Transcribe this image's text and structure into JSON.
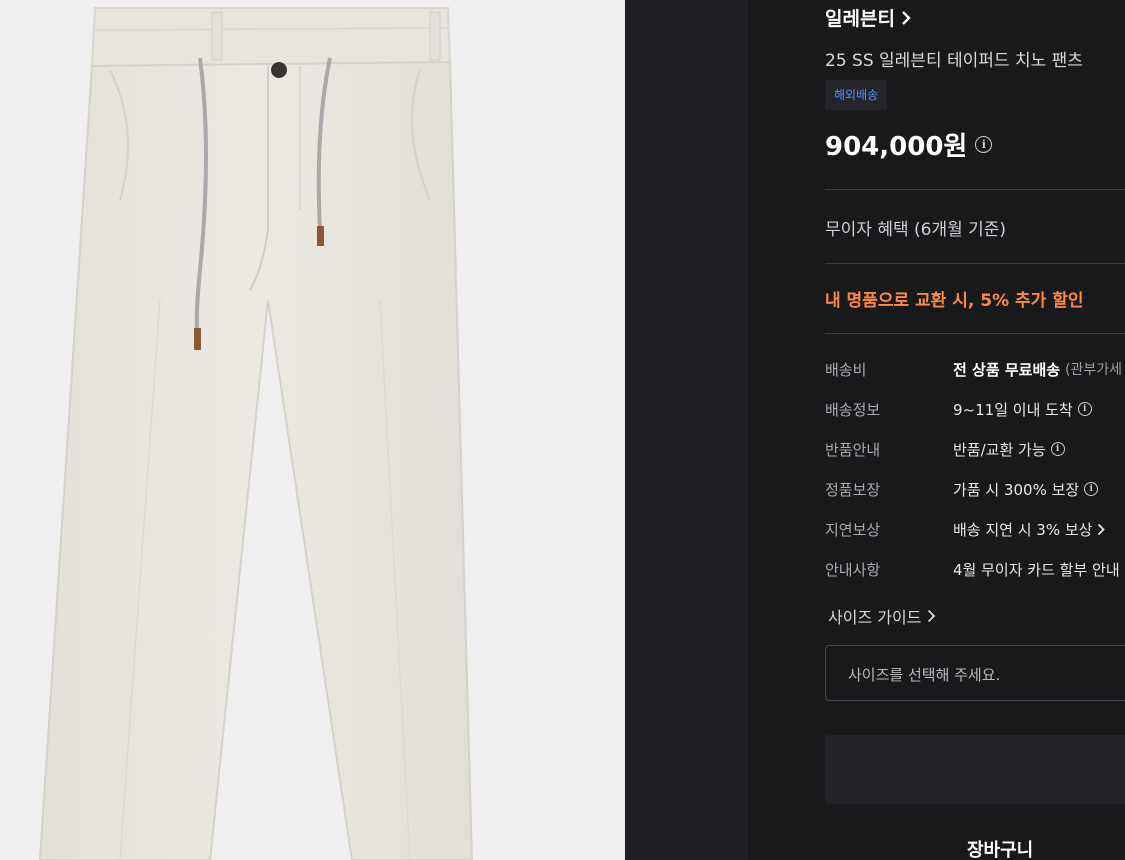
{
  "brand": {
    "name": "일레븐티"
  },
  "product": {
    "title": "25 SS 일레븐티 테이퍼드 치노 팬츠",
    "badge": "해외배송",
    "price": "904,000원"
  },
  "benefit": "무이자 혜택 (6개월 기준)",
  "promo": "내 명품으로 교환 시, 5% 추가 할인",
  "info_rows": [
    {
      "label": "배송비",
      "value_bold": "전 상품 무료배송",
      "value_extra": "(관부가세 포함)"
    },
    {
      "label": "배송정보",
      "value": "9~11일 이내 도착"
    },
    {
      "label": "반품안내",
      "value": "반품/교환 가능"
    },
    {
      "label": "정품보장",
      "value": "가품 시 300% 보장"
    },
    {
      "label": "지연보상",
      "value": "배송 지연 시 3% 보상"
    },
    {
      "label": "안내사항",
      "value": "4월 무이자 카드 할부 안내"
    }
  ],
  "size_guide": "사이즈 가이드",
  "size_select": {
    "placeholder": "사이즈를 선택해 주세요."
  },
  "cart_button": "장바구니",
  "icons": {
    "info": "i",
    "chevron": "chevron-right-icon"
  },
  "colors": {
    "promo": "#ff8a3d",
    "badge_text": "#5a8dff",
    "panel_bg": "#18191b"
  }
}
